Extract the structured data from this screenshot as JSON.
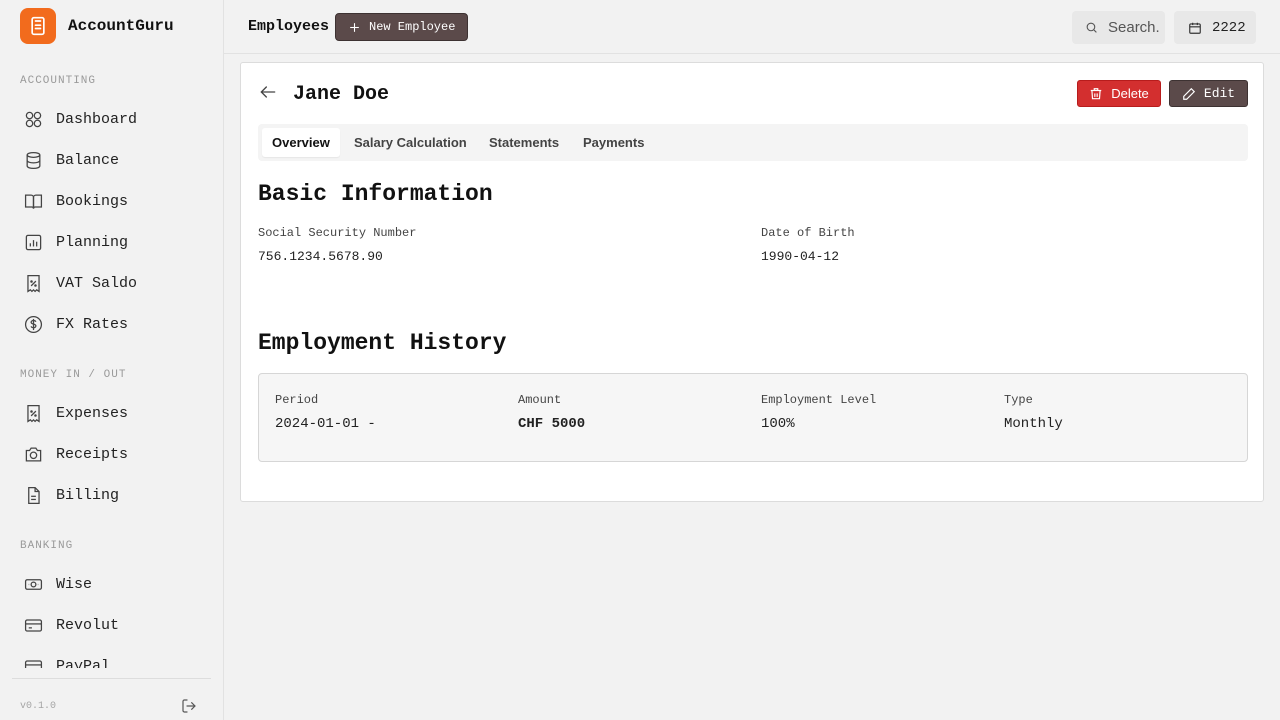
{
  "app": {
    "name": "AccountGuru",
    "version": "v0.1.0"
  },
  "sidebar": {
    "sections": [
      {
        "label": "ACCOUNTING",
        "items": [
          {
            "label": "Dashboard",
            "icon": "grid-icon"
          },
          {
            "label": "Balance",
            "icon": "database-icon"
          },
          {
            "label": "Bookings",
            "icon": "book-icon"
          },
          {
            "label": "Planning",
            "icon": "chart-icon"
          },
          {
            "label": "VAT Saldo",
            "icon": "receipt-percent-icon"
          },
          {
            "label": "FX Rates",
            "icon": "dollar-circle-icon"
          }
        ]
      },
      {
        "label": "MONEY IN / OUT",
        "items": [
          {
            "label": "Expenses",
            "icon": "receipt-percent-icon"
          },
          {
            "label": "Receipts",
            "icon": "camera-icon"
          },
          {
            "label": "Billing",
            "icon": "document-icon"
          }
        ]
      },
      {
        "label": "BANKING",
        "items": [
          {
            "label": "Wise",
            "icon": "banknote-icon"
          },
          {
            "label": "Revolut",
            "icon": "credit-card-icon"
          },
          {
            "label": "PayPal",
            "icon": "wallet-icon"
          }
        ]
      }
    ]
  },
  "header": {
    "title": "Employees",
    "new_button": "New Employee",
    "search_placeholder": "Search.",
    "year": "2222"
  },
  "employee": {
    "name": "Jane Doe",
    "delete_label": "Delete",
    "edit_label": "Edit",
    "tabs": [
      "Overview",
      "Salary Calculation",
      "Statements",
      "Payments"
    ],
    "basic": {
      "heading": "Basic Information",
      "ssn_label": "Social Security Number",
      "ssn_value": "756.1234.5678.90",
      "dob_label": "Date of Birth",
      "dob_value": "1990-04-12"
    },
    "history": {
      "heading": "Employment History",
      "columns": [
        "Period",
        "Amount",
        "Employment Level",
        "Type"
      ],
      "rows": [
        {
          "period": "2024-01-01 -",
          "amount": "CHF 5000",
          "level": "100%",
          "type": "Monthly"
        }
      ]
    }
  },
  "colors": {
    "accent": "#f26b1d",
    "primary_button": "#5b4a4a",
    "danger": "#d32f2f"
  }
}
